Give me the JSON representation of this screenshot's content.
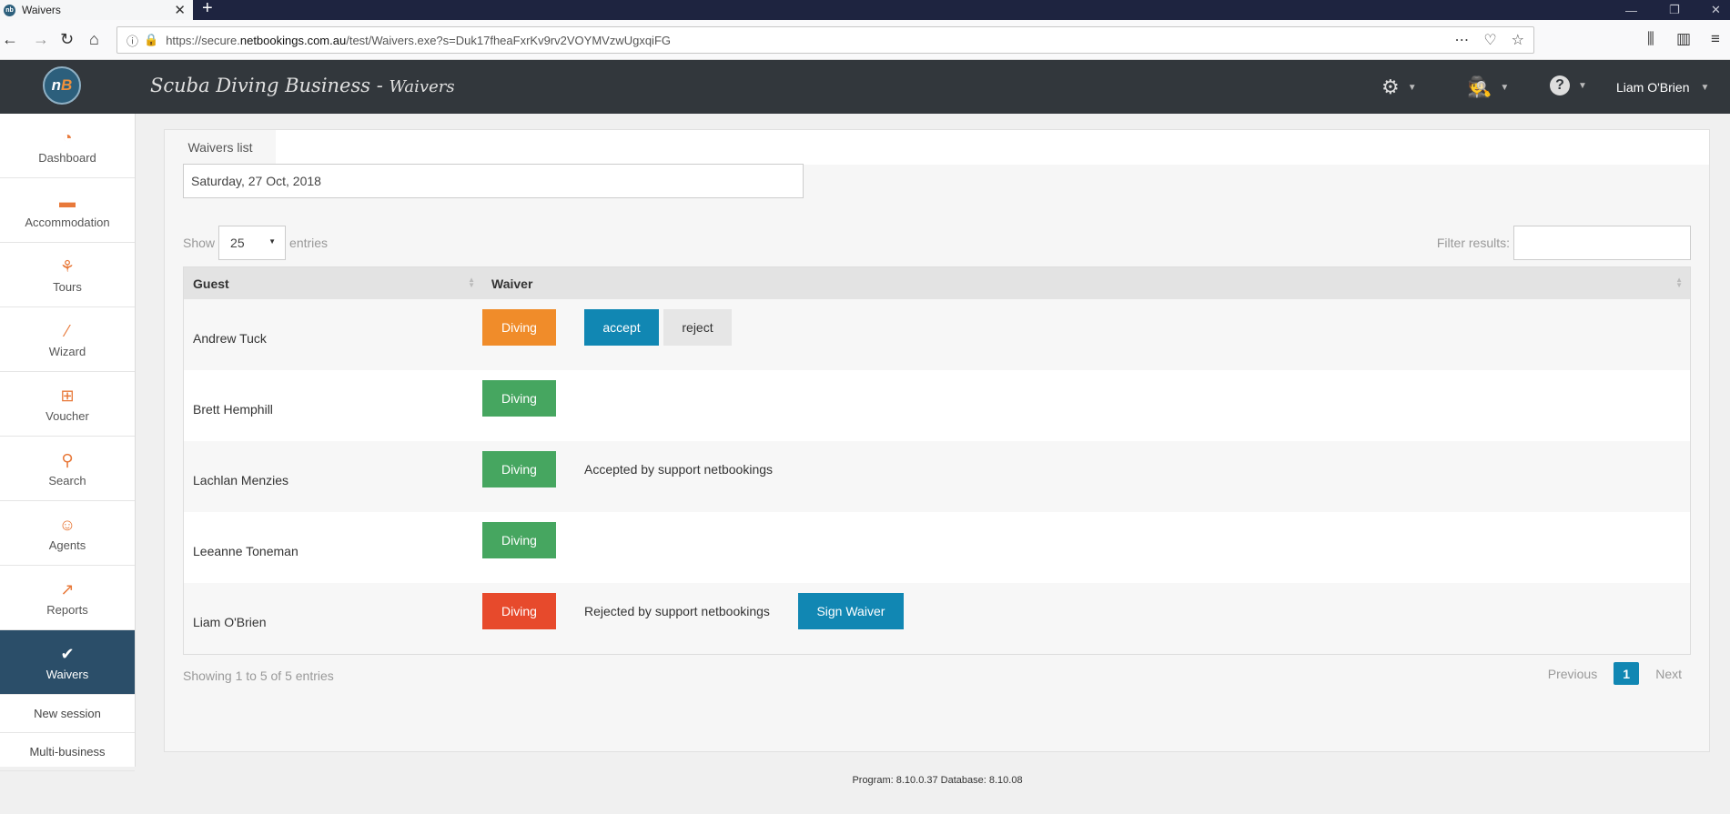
{
  "browser": {
    "tab_title": "Waivers",
    "tab_favicon_text": "nb",
    "url_prefix": "https://secure.",
    "url_domain": "netbookings.com.au",
    "url_rest": "/test/Waivers.exe?s=Duk17fheaFxrKv9rv2VOYMVzwUgxqiFG"
  },
  "header": {
    "logo_n": "n",
    "logo_b": "B",
    "business": "Scuba Diving Business",
    "separator": " - ",
    "page": "Waivers",
    "user": "Liam O'Brien"
  },
  "sidebar": {
    "items": [
      {
        "label": "Dashboard",
        "icon": "dashboard-icon"
      },
      {
        "label": "Accommodation",
        "icon": "bed-icon"
      },
      {
        "label": "Tours",
        "icon": "tours-icon"
      },
      {
        "label": "Wizard",
        "icon": "wand-icon"
      },
      {
        "label": "Voucher",
        "icon": "gift-icon"
      },
      {
        "label": "Search",
        "icon": "search-icon"
      },
      {
        "label": "Agents",
        "icon": "agent-icon"
      },
      {
        "label": "Reports",
        "icon": "chart-icon"
      },
      {
        "label": "Waivers",
        "icon": "check-icon",
        "active": true
      }
    ],
    "links": [
      "New session",
      "Multi-business"
    ]
  },
  "content": {
    "tab_label": "Waivers list",
    "date_value": "Saturday, 27 Oct, 2018",
    "show_label": "Show",
    "entries_value": "25",
    "entries_label": "entries",
    "filter_label": "Filter results:",
    "filter_value": "",
    "columns": [
      "Guest",
      "Waiver"
    ],
    "rows": [
      {
        "guest": "Andrew Tuck",
        "waiver": "Diving",
        "color": "#f08c2a",
        "accept": "accept",
        "reject": "reject"
      },
      {
        "guest": "Brett Hemphill",
        "waiver": "Diving",
        "color": "#46a660"
      },
      {
        "guest": "Lachlan Menzies",
        "waiver": "Diving",
        "color": "#46a660",
        "status": "Accepted by support netbookings"
      },
      {
        "guest": "Leeanne Toneman",
        "waiver": "Diving",
        "color": "#46a660"
      },
      {
        "guest": "Liam O'Brien",
        "waiver": "Diving",
        "color": "#e74a2c",
        "status": "Rejected by support netbookings",
        "sign": "Sign Waiver"
      }
    ],
    "showing": "Showing 1 to 5 of 5 entries",
    "pager": {
      "previous": "Previous",
      "current": "1",
      "next": "Next"
    }
  },
  "footer": "Program: 8.10.0.37 Database: 8.10.08",
  "colors": {
    "accent": "#1187b3",
    "sidebar_active": "#2b4e69",
    "header_bg": "#32373c",
    "icon_orange": "#e8793a"
  }
}
